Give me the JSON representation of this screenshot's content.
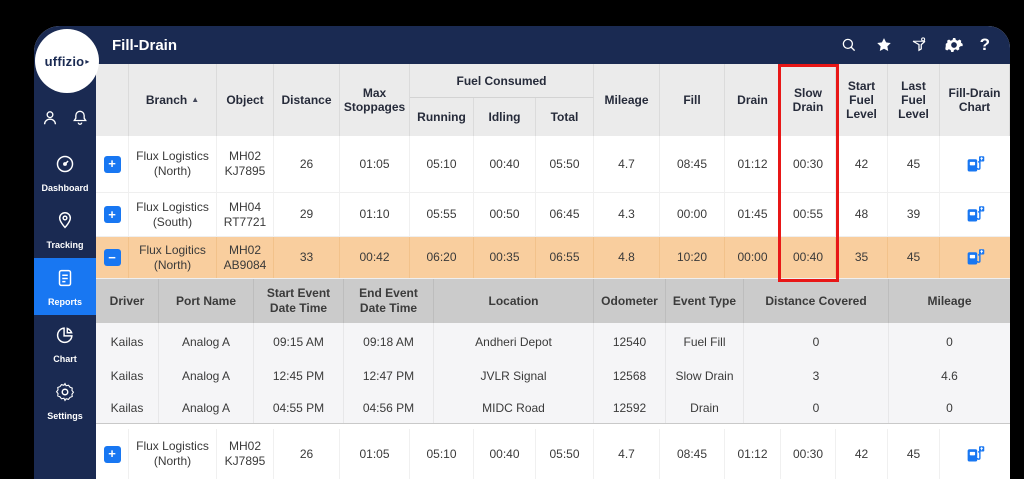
{
  "app": {
    "title": "Fill-Drain"
  },
  "logo": {
    "text": "uffizio",
    "mark": "▸"
  },
  "header_icons": {
    "help_label": "?"
  },
  "sidebar": {
    "items": [
      {
        "label": "Dashboard"
      },
      {
        "label": "Tracking"
      },
      {
        "label": "Reports"
      },
      {
        "label": "Chart"
      },
      {
        "label": "Settings"
      }
    ]
  },
  "table": {
    "headers": {
      "branch": "Branch",
      "sort": "▲",
      "object": "Object",
      "distance": "Distance",
      "max_stoppages": "Max Stoppages",
      "fuel_consumed": "Fuel Consumed",
      "running": "Running",
      "idling": "Idling",
      "total": "Total",
      "mileage": "Mileage",
      "fill": "Fill",
      "drain": "Drain",
      "slow_drain": "Slow Drain",
      "start_fuel": "Start Fuel Level",
      "last_fuel": "Last Fuel Level",
      "chart": "Fill-Drain Chart"
    },
    "rows": [
      {
        "expander": "+",
        "branch": "Flux Logistics (North)",
        "object": "MH02 KJ7895",
        "distance": "26",
        "max_stoppages": "01:05",
        "running": "05:10",
        "idling": "00:40",
        "total": "05:50",
        "mileage": "4.7",
        "fill": "08:45",
        "drain": "01:12",
        "slow_drain": "00:30",
        "start_fuel": "42",
        "last_fuel": "45"
      },
      {
        "expander": "+",
        "branch": "Flux Logistics (South)",
        "object": "MH04 RT7721",
        "distance": "29",
        "max_stoppages": "01:10",
        "running": "05:55",
        "idling": "00:50",
        "total": "06:45",
        "mileage": "4.3",
        "fill": "00:00",
        "drain": "01:45",
        "slow_drain": "00:55",
        "start_fuel": "48",
        "last_fuel": "39"
      },
      {
        "expander": "−",
        "branch": "Flux Logitics (North)",
        "object": "MH02 AB9084",
        "distance": "33",
        "max_stoppages": "00:42",
        "running": "06:20",
        "idling": "00:35",
        "total": "06:55",
        "mileage": "4.8",
        "fill": "10:20",
        "drain": "00:00",
        "slow_drain": "00:40",
        "start_fuel": "35",
        "last_fuel": "45"
      },
      {
        "expander": "+",
        "branch": "Flux Logistics (North)",
        "object": "MH02 KJ7895",
        "distance": "26",
        "max_stoppages": "01:05",
        "running": "05:10",
        "idling": "00:40",
        "total": "05:50",
        "mileage": "4.7",
        "fill": "08:45",
        "drain": "01:12",
        "slow_drain": "00:30",
        "start_fuel": "42",
        "last_fuel": "45"
      }
    ]
  },
  "detail": {
    "headers": [
      "Driver",
      "Port Name",
      "Start Event Date Time",
      "End Event Date Time",
      "Location",
      "Odometer",
      "Event Type",
      "Distance Covered",
      "Mileage"
    ],
    "rows": [
      [
        "Kailas",
        "Analog A",
        "09:15 AM",
        "09:18 AM",
        "Andheri Depot",
        "12540",
        "Fuel Fill",
        "0",
        "0"
      ],
      [
        "Kailas",
        "Analog A",
        "12:45 PM",
        "12:47 PM",
        "JVLR Signal",
        "12568",
        "Slow Drain",
        "3",
        "4.6"
      ],
      [
        "Kailas",
        "Analog A",
        "04:55 PM",
        "04:56 PM",
        "MIDC Road",
        "12592",
        "Drain",
        "0",
        "0"
      ]
    ]
  },
  "colors": {
    "navy": "#1A2A52",
    "accent_blue": "#1877F2",
    "row_highlight": "#F9CE9E",
    "positive_green": "#21A53E",
    "negative_red": "#F43B33",
    "highlight_box_red": "#E81717"
  }
}
